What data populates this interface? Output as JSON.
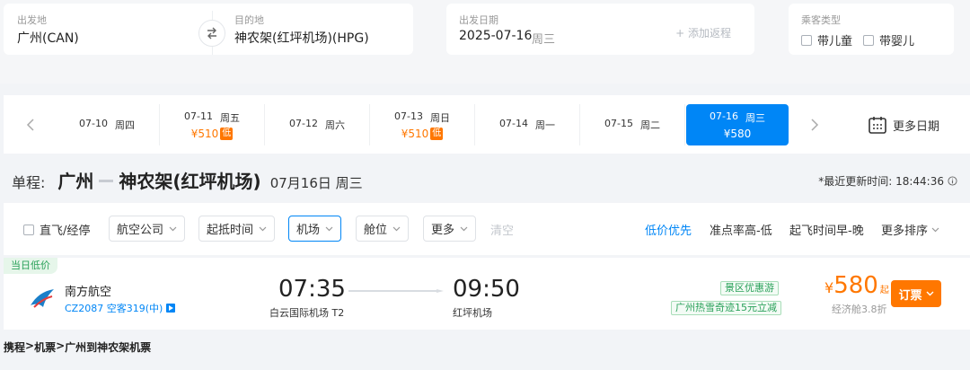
{
  "search": {
    "origin_label": "出发地",
    "origin_value": "广州(CAN)",
    "dest_label": "目的地",
    "dest_value": "神农架(红坪机场)(HPG)",
    "date_label": "出发日期",
    "date_value": "2025-07-16",
    "date_weekday": "周三",
    "add_return": "+ 添加返程",
    "passenger_label": "乘客类型",
    "child_label": "带儿童",
    "infant_label": "带婴儿"
  },
  "date_strip": {
    "dates": [
      {
        "date": "07-10",
        "weekday": "周四",
        "price": "",
        "low": ""
      },
      {
        "date": "07-11",
        "weekday": "周五",
        "price": "¥510",
        "low": "低"
      },
      {
        "date": "07-12",
        "weekday": "周六",
        "price": "",
        "low": ""
      },
      {
        "date": "07-13",
        "weekday": "周日",
        "price": "¥510",
        "low": "低"
      },
      {
        "date": "07-14",
        "weekday": "周一",
        "price": "",
        "low": ""
      },
      {
        "date": "07-15",
        "weekday": "周二",
        "price": "",
        "low": ""
      },
      {
        "date": "07-16",
        "weekday": "周三",
        "price": "¥580",
        "low": ""
      }
    ],
    "more_dates": "更多日期"
  },
  "route": {
    "prefix": "单程:",
    "from": "广州",
    "to": "神农架(红坪机场)",
    "date": "07月16日 周三",
    "update_time": "*最近更新时间: 18:44:36"
  },
  "filters": {
    "direct": "直飞/经停",
    "airline": "航空公司",
    "time": "起抵时间",
    "airport": "机场",
    "cabin": "舱位",
    "more": "更多",
    "clear": "清空",
    "sort_low_price": "低价优先",
    "sort_ontime": "准点率高-低",
    "sort_departure": "起飞时间早-晚",
    "sort_more": "更多排序"
  },
  "flight": {
    "today_low": "当日低价",
    "airline": "南方航空",
    "flight_no": "CZ2087 空客319(中)",
    "dep_time": "07:35",
    "dep_airport": "白云国际机场 T2",
    "arr_time": "09:50",
    "arr_airport": "红坪机场",
    "promo1": "景区优惠游",
    "promo2": "广州热雪奇迹15元立减",
    "price_currency": "¥",
    "price": "580",
    "price_suffix": "起",
    "cabin": "经济舱3.8折",
    "book": "订票"
  },
  "breadcrumb": {
    "items": [
      "携程",
      "机票",
      "广州到神农架机票"
    ],
    "sep": ">"
  },
  "colors": {
    "accent": "#0086f6",
    "price": "#ff7700",
    "promo": "#2aa15a"
  }
}
